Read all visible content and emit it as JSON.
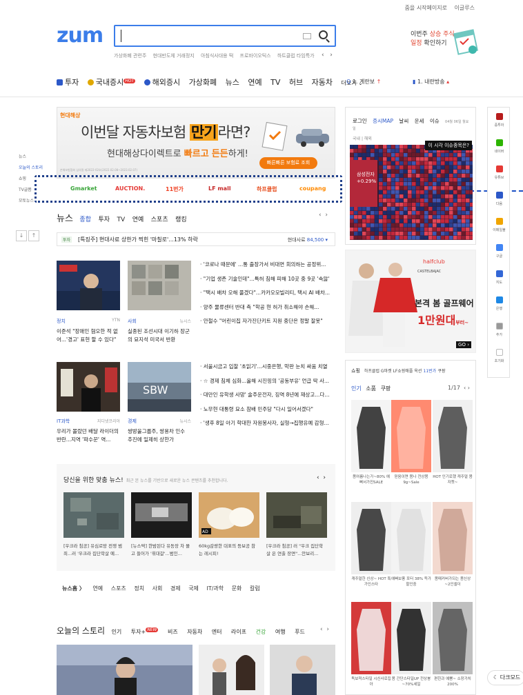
{
  "top_links": [
    "줌을 시작페이지로",
    "이글루스"
  ],
  "logo": "zum",
  "search": {
    "value": ""
  },
  "trending_keywords": [
    "가상화폐 관련주",
    "현대반도체 거래정지",
    "아침식사대용 떡",
    "프로바이오틱스",
    "하트클럽 타임특가"
  ],
  "promo": {
    "line1_a": "이번주 ",
    "line1_b": "상승 주식",
    "line2_a": "일정",
    "line2_b": " 확인하기"
  },
  "nav": {
    "items": [
      {
        "label": "투자",
        "color": "#2c58c8"
      },
      {
        "label": "국내증시",
        "color": "#e0a800",
        "hot": "HOT"
      },
      {
        "label": "해외증시",
        "color": "#2c58c8"
      },
      {
        "label": "가상화폐"
      },
      {
        "label": "뉴스"
      },
      {
        "label": "연예"
      },
      {
        "label": "TV"
      },
      {
        "label": "허브"
      },
      {
        "label": "자동차"
      }
    ],
    "more": "더보기",
    "right1": "계란보",
    "right2": "내란방송"
  },
  "side_menu": {
    "items": [
      "뉴스",
      "오늘의 스토리",
      "쇼핑",
      "TV글쯤",
      "모토뉴스"
    ],
    "active": "오늘의 스토리"
  },
  "ad": {
    "brand": "현대해상",
    "headline_a": "이번달 자동차보험 ",
    "headline_b": "만기",
    "headline_c": "라면?",
    "sub_a": "현대해상다이렉트로 ",
    "sub_b": "빠르고",
    "sub_c": " ",
    "sub_d": "든든",
    "sub_e": "하게!",
    "cta": "빠른빠른 보험료 조회",
    "fine": "손해보험협회 심의필 제2022-02호(2022.02.08~2023.02.07)"
  },
  "shops": [
    {
      "label": "Gmarket",
      "color": "#3aa53a"
    },
    {
      "label": "AUCTION.",
      "color": "#e53935"
    },
    {
      "label": "11번가",
      "color": "#ef4123"
    },
    {
      "label": "LF mall",
      "color": "#c62828"
    },
    {
      "label": "하프클럽",
      "color": "#e64a19"
    },
    {
      "label": "coupang",
      "color": "#ff8a00"
    }
  ],
  "news_section": {
    "title": "뉴스",
    "tabs": [
      "종합",
      "투자",
      "TV",
      "연예",
      "스포츠",
      "랭킹"
    ],
    "active": "종합"
  },
  "ticker": {
    "tag": "투자",
    "text": "[특징주] 현대사료 상한가 찍힌 '마칠로'...13% 하락",
    "stock": "현대사료",
    "price": "84,500 ▾"
  },
  "news_cards": [
    {
      "cat": "정치",
      "src": "YTN",
      "title": "이준석 \"장애인 혐오한 적 없어...'경고' 표현 할 수 있다\""
    },
    {
      "cat": "사회",
      "src": "뉴시스",
      "title": "실종된 조선시대 이기하 장군의 묘지석 미국서 반환"
    },
    {
      "cat": "IT과학",
      "src": "지디넷코리아",
      "title": "우리가 몰랐던 배달 라이더의 반란...지역 '파수꾼' 역..."
    },
    {
      "cat": "경제",
      "src": "뉴시스",
      "title": "쌍방울그룹주, 쌍용차 인수 추진에 일제히 상한가"
    }
  ],
  "bullet_news_1": [
    "· '코로나 때문에' ...통 출장가서 비대면 회의하는 공정위...",
    "· \"기업 생존 기술인데\"...특허 침해 피해 10곳 중 9곳 '속앓'",
    "· \"택시 배차 오해 풀겠다\"...카카오모빌리티, 택시 AI 배차...",
    "· 양주 물류센터 반대 측 \"학공 현 허가 취소해야 손해...",
    "· 안철수 \"어린이집 자가진단키트 지원 중단은 정말 잘못\""
  ],
  "bullet_news_2": [
    "· 서울시금고 입찰 '초읽기'...시중은행, 막판 눈치 싸움 치열",
    "· ☆ 경제 침체 심화...올해 시진핑의 '공동부유' 언급 딱 사...",
    "· 대만인 유학생 사망' 술주운전자, 징역 8년에 재상고...다...",
    "· 노무현 대통령 묘소 참배 민주당 \"다시 일어서겠다\"",
    "· '생후 8일 아기 학대한 자원봉사자, 실형→집행유예 감형..."
  ],
  "recommend": {
    "title": "당신을 위한 맞춤 뉴스!",
    "desc": "최근 본 뉴스를 기반으로 새로운 뉴스 콘텐츠를 추천합니다.",
    "items": [
      "[우크라 침공] 유심로망 전쟁 범죄...러 '우크라 집단학살 예...",
      "[뉴스딱] 한밤된다 유동장 차 몰고 들어가 '휘대갈'...범인...",
      "60kg감량한 대표의 등보공 참는 레시피!",
      "[우크라 침공] 러 \"우크 집단학살 은 연출 장면\"...안보리..."
    ],
    "ad_badge": "AD"
  },
  "news_home": {
    "label": "뉴스홈 〉",
    "links": [
      "연예",
      "스포츠",
      "정치",
      "사회",
      "경제",
      "국제",
      "IT/과학",
      "문화",
      "칼럼"
    ]
  },
  "story": {
    "title": "오늘의 스토리",
    "tabs": [
      "인기",
      "투자+",
      "비즈",
      "자동차",
      "엔터",
      "라이프",
      "건강",
      "여행",
      "푸드"
    ],
    "new_badge": "NEW",
    "active": "건강"
  },
  "stock_panel": {
    "tabs": [
      "로그인",
      "증시MAP",
      "날씨",
      "운세",
      "이슈"
    ],
    "date": "04월 06일 월요일",
    "sub": "국내 | 해외",
    "tooltip": "이 시각 이슈종목은?",
    "label1": "삼성전자",
    "label2": "+0.29%"
  },
  "banner": {
    "brand": "halfclub",
    "sub": "CASTELBAJAC",
    "line1": "본격 봄 골프웨어",
    "line2": "1만원대",
    "line2_suffix": "부터~",
    "go": "GO ›"
  },
  "shopping": {
    "title": "쇼핑",
    "desc": "하프클럽 G마켓 LF쇼핑애플 옥션",
    "count": "11번가",
    "more": "쿠팡",
    "tabs": [
      "인기",
      "소품",
      "쿠팡"
    ],
    "page": "1/17",
    "items": [
      "봄여름나는가~80% 예뻐서가진SALE",
      "믿음이면 봄나 전상봄9g~Sale",
      "HOT 인기로했 캐주얼 봄자켓~",
      "캐주얼한 신상~ HOT 특가인스타",
      "예뻐보풍 포터 38% 득가할인중",
      "몸매커버가되는 봄신상~2인셀더",
      "독보적스타일 시신사로집아",
      "봄 간단스타일UP 전상봉~70%세일",
      "편한과 예쁨~ 소장가치200%"
    ]
  },
  "rail": [
    "증투자",
    "네이버",
    "유튜브",
    "다음",
    "이메일불",
    "구글",
    "지도",
    "은행",
    "추가",
    "초기화"
  ],
  "rail_colors": [
    "#b71c1c",
    "#2db400",
    "#e53935",
    "#2c58c8",
    "#f0a500",
    "#4285f4",
    "#3367d6",
    "#1e88e5",
    "#999999",
    "#ffffff"
  ],
  "bottom_button": "다크모드"
}
